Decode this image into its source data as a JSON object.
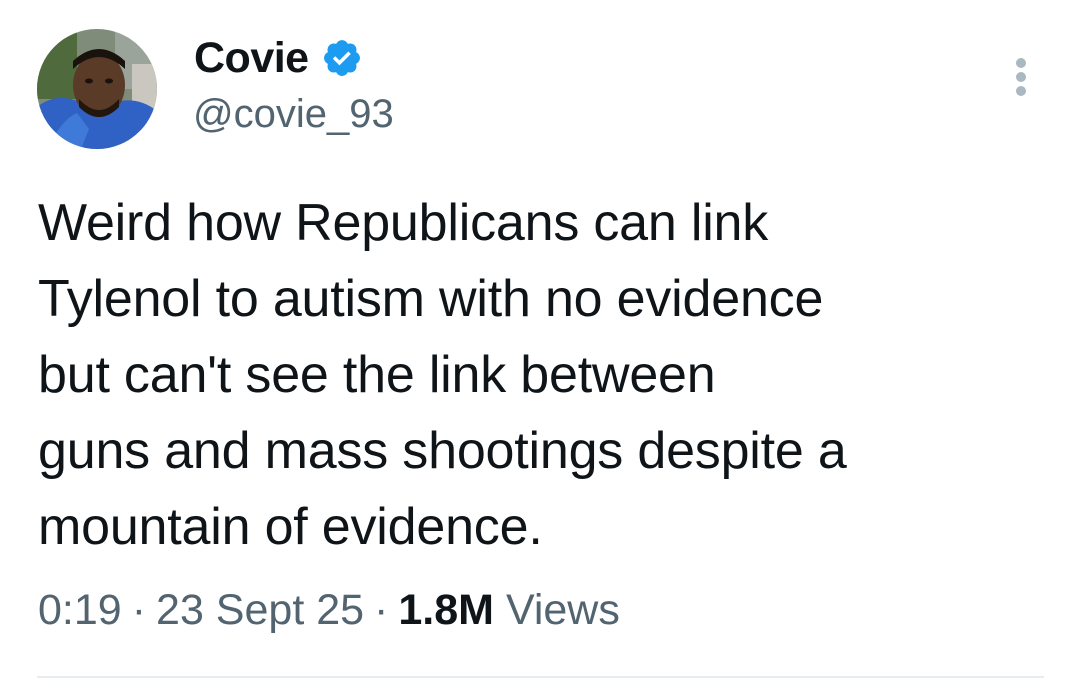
{
  "author": {
    "display_name": "Covie",
    "handle": "@covie_93",
    "verified": true,
    "verified_icon": "verified-badge-icon",
    "avatar_icon": "profile-photo"
  },
  "tweet": {
    "text": "Weird how Republicans can link\nTylenol to autism with no evidence\nbut can't see the link between\nguns and mass shootings despite a\nmountain of evidence."
  },
  "meta": {
    "time": "0:19",
    "separator": "·",
    "date": "23 Sept 25",
    "views_count": "1.8M",
    "views_label": "Views"
  },
  "more_icon": "more-options-icon",
  "colors": {
    "text_primary": "#0f1419",
    "text_secondary": "#536471",
    "verified_blue": "#1d9bf0",
    "divider": "#e6ecf0"
  }
}
